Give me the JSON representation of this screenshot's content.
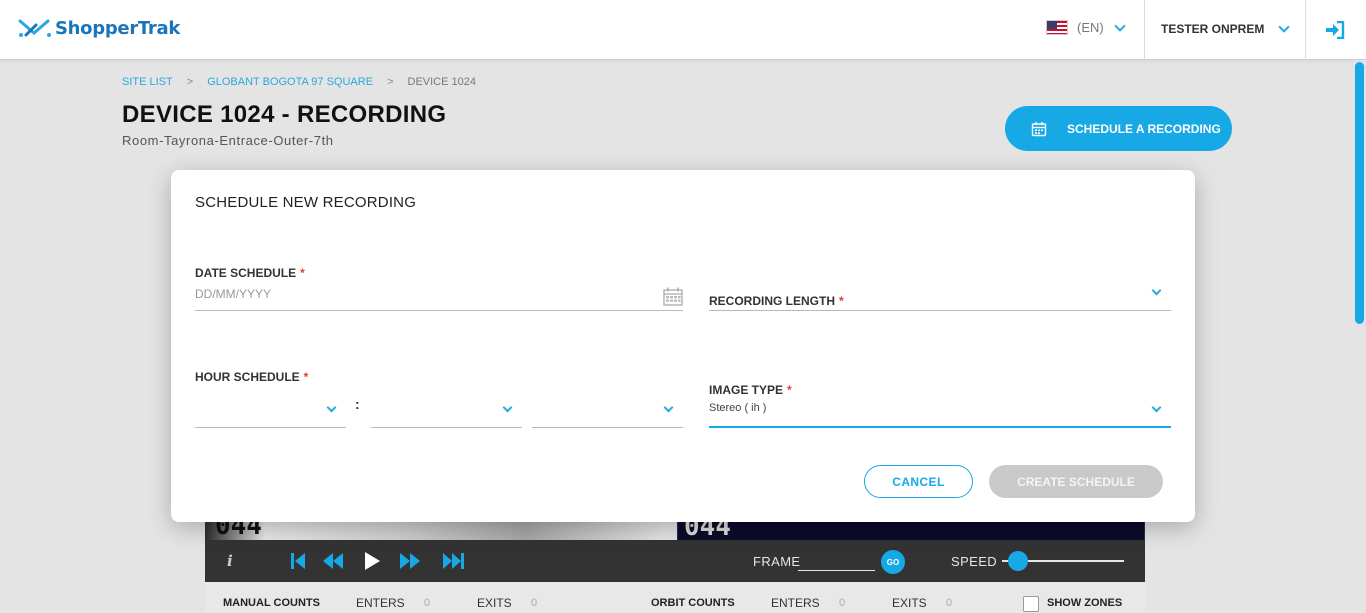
{
  "header": {
    "brand": "ShopperTrak",
    "language": "(EN)",
    "user": "TESTER ONPREM",
    "icons": {
      "logo": "shoppertrak-logo",
      "flag": "us-flag-icon",
      "logout": "logout-icon"
    }
  },
  "breadcrumb": {
    "items": [
      "SITE LIST",
      "GLOBANT BOGOTA 97 SQUARE",
      "DEVICE 1024"
    ],
    "separator": ">"
  },
  "page": {
    "title": "DEVICE 1024 - RECORDING",
    "subtitle": "Room-Tayrona-Entrace-Outer-7th",
    "schedule_button": "SCHEDULE A RECORDING"
  },
  "modal": {
    "title": "SCHEDULE NEW RECORDING",
    "date_schedule": {
      "label": "DATE SCHEDULE",
      "placeholder": "DD/MM/YYYY",
      "required": "*"
    },
    "recording_length": {
      "label": "RECORDING LENGTH",
      "required": "*",
      "value": ""
    },
    "hour_schedule": {
      "label": "HOUR SCHEDULE",
      "required": "*",
      "separator": ":"
    },
    "image_type": {
      "label": "IMAGE TYPE",
      "required": "*",
      "value": "Stereo ( ih )"
    },
    "cancel": "CANCEL",
    "create": "CREATE SCHEDULE"
  },
  "player": {
    "info": "i",
    "frame_label": "FRAME",
    "go": "GO",
    "speed_label": "SPEED",
    "overlay_left": "044",
    "overlay_right": "044"
  },
  "counts": {
    "manual_label": "MANUAL COUNTS",
    "orbit_label": "ORBIT COUNTS",
    "enters": "ENTERS",
    "exits": "EXITS",
    "manual_enters": "0",
    "manual_exits": "0",
    "orbit_enters": "0",
    "orbit_exits": "0",
    "show_zones": "SHOW ZONES"
  },
  "colors": {
    "accent": "#17a8e6",
    "brand": "#1b75bb",
    "required": "#e53935",
    "disabled_button": "#c9c9c9",
    "player_bg": "#333333"
  }
}
